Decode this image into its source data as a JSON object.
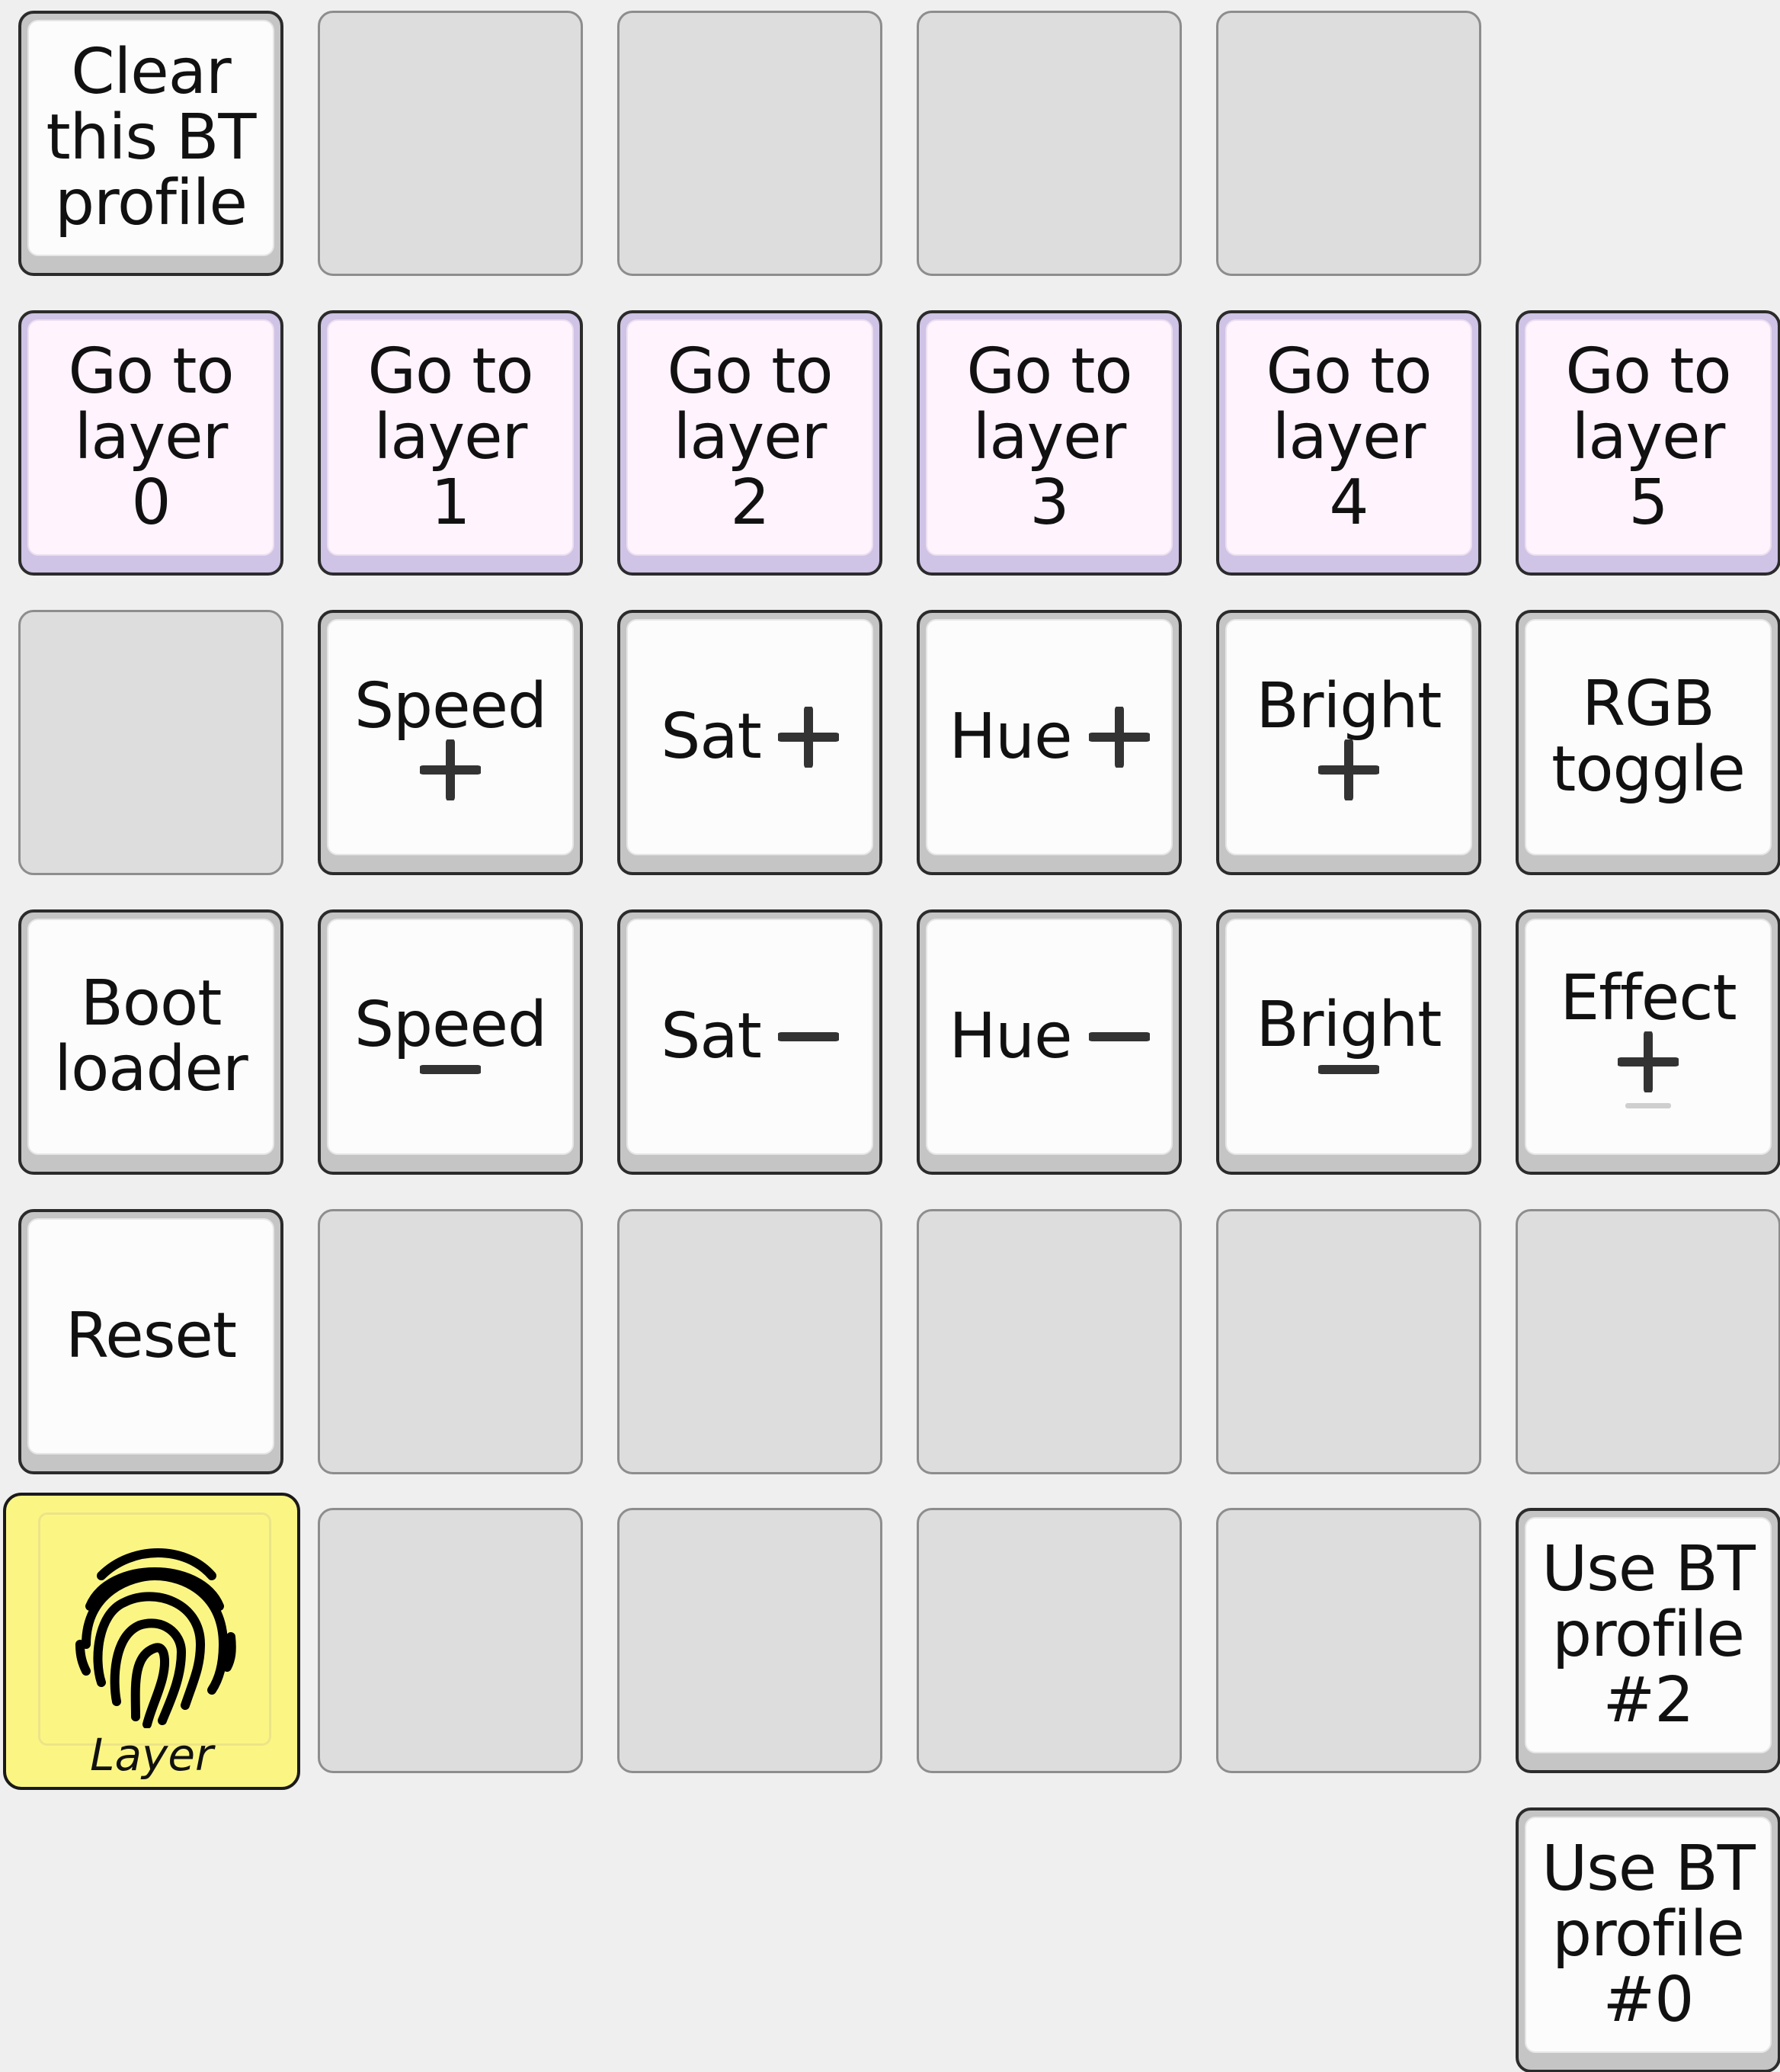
{
  "keys": {
    "clear_bt": "Clear\nthis BT\nprofile",
    "goto0": "Go to\nlayer\n0",
    "goto1": "Go to\nlayer\n1",
    "goto2": "Go to\nlayer\n2",
    "goto3": "Go to\nlayer\n3",
    "goto4": "Go to\nlayer\n4",
    "goto5": "Go to\nlayer\n5",
    "speed_up": "Speed",
    "sat_up": "Sat",
    "hue_up": "Hue",
    "bright_up": "Bright",
    "rgb_toggle": "RGB\ntoggle",
    "bootloader": "Boot\nloader",
    "speed_down": "Speed",
    "sat_down": "Sat",
    "hue_down": "Hue",
    "bright_down": "Bright",
    "effect": "Effect",
    "reset": "Reset",
    "layer": "Layer",
    "bt2": "Use BT\nprofile\n#2",
    "bt0": "Use BT\nprofile\n#0"
  },
  "icons": {
    "plus": "plus-icon",
    "minus": "minus-icon",
    "layer": "fingerprint-icon"
  },
  "colors": {
    "empty_key": "#dddddd",
    "white_key": "#fcfcfc",
    "layer_key": "#fff3fd",
    "layer_hold_key": "#fbf684",
    "background": "#efefef"
  }
}
